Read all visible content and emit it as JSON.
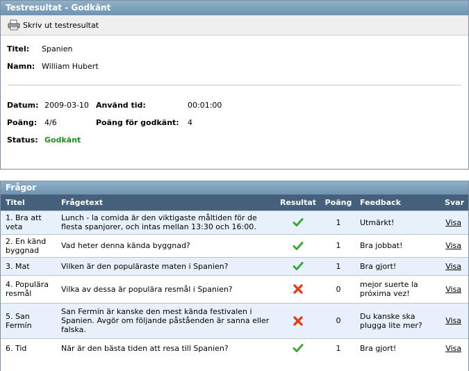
{
  "result": {
    "header": "Testresultat - Godkänt",
    "print_label": "Skriv ut testresultat",
    "title_label": "Titel:",
    "title_value": "Spanien",
    "name_label": "Namn:",
    "name_value": "William Hubert",
    "date_label": "Datum:",
    "date_value": "2009-03-10",
    "time_label": "Använd tid:",
    "time_value": "00:01:00",
    "points_label": "Poäng:",
    "points_value": "4/6",
    "pass_points_label": "Poäng för godkänt:",
    "pass_points_value": "4",
    "status_label": "Status:",
    "status_value": "Godkänt",
    "status_color": "#1f8a1f"
  },
  "questions": {
    "header": "Frågor",
    "columns": {
      "title": "Titel",
      "text": "Frågetext",
      "result": "Resultat",
      "points": "Poäng",
      "feedback": "Feedback",
      "answer": "Svar"
    },
    "rows": [
      {
        "title": "1. Bra att veta",
        "text": "Lunch - la comida är den viktigaste måltiden för de flesta spanjorer, och intas mellan 13:30 och 16:00.",
        "result": "check-icon",
        "points": "1",
        "feedback": "Utmärkt!",
        "answer": "Visa"
      },
      {
        "title": "2. En känd byggnad",
        "text": "Vad heter denna kända byggnad?",
        "result": "check-icon",
        "points": "1",
        "feedback": "Bra jobbat!",
        "answer": "Visa"
      },
      {
        "title": "3. Mat",
        "text": "Vilken är den populäraste maten i Spanien?",
        "result": "check-icon",
        "points": "1",
        "feedback": "Bra gjort!",
        "answer": "Visa"
      },
      {
        "title": "4. Populära resmål",
        "text": "Vilka av dessa är populära resmål i Spanien?",
        "result": "cross-icon",
        "points": "0",
        "feedback": "mejor suerte la próxima vez!",
        "answer": "Visa"
      },
      {
        "title": "5. San Fermín",
        "text": "San Fermín är kanske den mest kända festivalen i Spanien. Avgör om följande påståenden är sanna eller falska.",
        "result": "cross-icon",
        "points": "0",
        "feedback": "Du kanske ska plugga lite mer?",
        "answer": "Visa"
      },
      {
        "title": "6. Tid",
        "text": "När är den bästa tiden att resa till Spanien?",
        "result": "check-icon",
        "points": "1",
        "feedback": "Bra gjort!",
        "answer": "Visa"
      }
    ]
  },
  "colors": {
    "header_bg": "#7b9dba",
    "table_header_bg": "#44607a",
    "row_alt_bg": "#e7f0fb",
    "check": "#3aa63a",
    "cross": "#e0401e"
  }
}
